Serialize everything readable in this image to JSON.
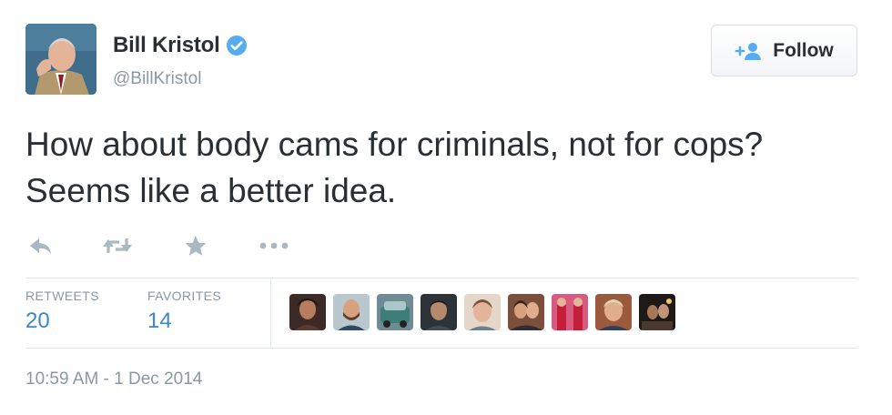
{
  "author": {
    "display_name": "Bill Kristol",
    "handle": "@BillKristol",
    "verified": true
  },
  "follow_button": {
    "label": "Follow"
  },
  "tweet": {
    "text": "How about body cams for criminals, not for cops? Seems like a better idea."
  },
  "actions": [
    {
      "name": "reply",
      "icon": "reply-icon"
    },
    {
      "name": "retweet",
      "icon": "retweet-icon"
    },
    {
      "name": "favorite",
      "icon": "star-icon"
    },
    {
      "name": "more",
      "icon": "more-dots-icon"
    }
  ],
  "stats": {
    "retweets_label": "RETWEETS",
    "retweets_count": "20",
    "favorites_label": "FAVORITES",
    "favorites_count": "14"
  },
  "favoriters_count_shown": 9,
  "timestamp": "10:59 AM - 1 Dec 2014",
  "colors": {
    "text": "#292f33",
    "muted": "#8899a6",
    "link_blue": "#3b88c3",
    "verified_blue": "#55acee",
    "action_gray": "#aab8c2",
    "divider": "#e1e8ed"
  }
}
